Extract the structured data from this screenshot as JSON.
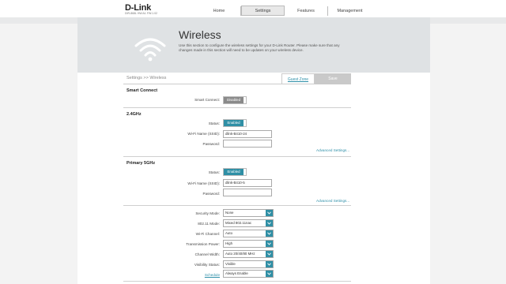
{
  "header": {
    "logo": "D-Link",
    "logo_sub": "DIR-868L   HW:A1   FW:1.02",
    "nav": [
      "Home",
      "Settings",
      "Features",
      "Management"
    ]
  },
  "banner": {
    "title": "Wireless",
    "description": "Use this section to configure the wireless settings for your D-Link Router. Please make sure that any changes made in this section will need to be updates on your wireless device."
  },
  "breadcrumb": "Settings >> Wireless",
  "guest_zone": "Guest Zone",
  "save": "Save",
  "smart_connect": {
    "title": "Smart Connect",
    "label": "Smart Connect:",
    "value": "Disabled"
  },
  "band24": {
    "title": "2.4GHz",
    "status_label": "Status:",
    "status": "Enabled",
    "ssid_label": "Wi-Fi Name (SSID):",
    "ssid": "dlink-B410-24",
    "password_label": "Password:",
    "password": "",
    "advanced": "Advanced Settings..."
  },
  "band5": {
    "title": "Primary 5GHz",
    "status_label": "Status:",
    "status": "Enabled",
    "ssid_label": "Wi-Fi Name (SSID):",
    "ssid": "dlink-B410-5",
    "password_label": "Password:",
    "password": "",
    "advanced": "Advanced Settings..."
  },
  "advanced_fields": [
    {
      "label": "Security Mode:",
      "value": "None"
    },
    {
      "label": "802.11 Mode:",
      "value": "Mixed 802.11nac"
    },
    {
      "label": "Wi-Fi Channel:",
      "value": "Auto"
    },
    {
      "label": "Transmission Power:",
      "value": "High"
    },
    {
      "label": "Channel Width:",
      "value": "Auto 20/40/80 MHz"
    },
    {
      "label": "Visibility Status:",
      "value": "Visible"
    },
    {
      "label": "Schedule",
      "value": "Always Enable"
    }
  ],
  "colors": {
    "accent": "#2f8fa5",
    "disabled": "#8a8a8a",
    "banner": "#dfe2e4"
  }
}
